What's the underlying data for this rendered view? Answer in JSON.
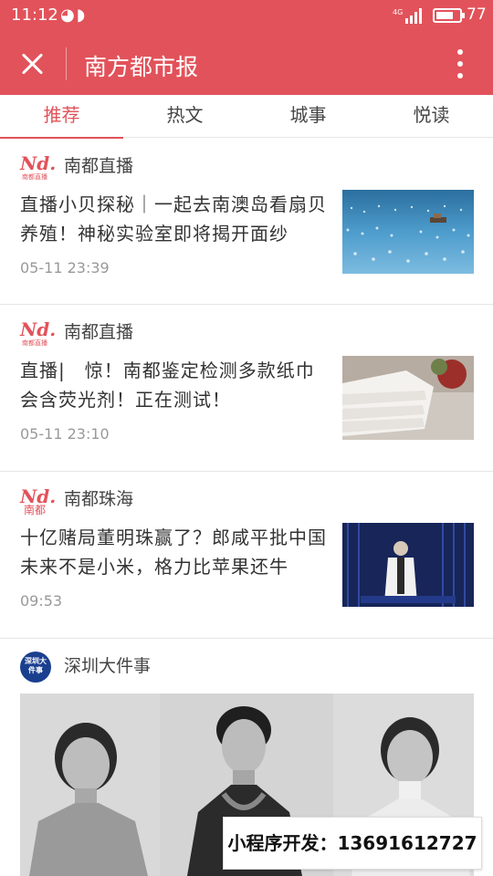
{
  "status_bar": {
    "time": "11:12",
    "network": "4G",
    "battery": "77",
    "battery_level": 0.77
  },
  "header": {
    "title": "南方都市报",
    "background": "#e2525a",
    "close_icon": "close-icon",
    "more_icon": "more-vertical-icon"
  },
  "tabs": [
    {
      "label": "推荐",
      "active": true
    },
    {
      "label": "热文",
      "active": false
    },
    {
      "label": "城事",
      "active": false
    },
    {
      "label": "悦读",
      "active": false
    }
  ],
  "articles": [
    {
      "source": "南都直播",
      "logo_text": "Nd.",
      "logo_sub": "南都直播",
      "headline": "直播小贝探秘｜一起去南澳岛看扇贝养殖！神秘实验室即将揭开面纱",
      "time": "05-11 23:39"
    },
    {
      "source": "南都直播",
      "logo_text": "Nd.",
      "logo_sub": "南都直播",
      "headline": "直播|　惊！南都鉴定检测多款纸巾会含荧光剂！正在测试！",
      "time": "05-11 23:10"
    },
    {
      "source": "南都珠海",
      "logo_text": "Nd.",
      "logo_sub": "南都",
      "headline": "十亿赌局董明珠赢了？郎咸平批中国未来不是小米，格力比苹果还牛",
      "time": "09:53"
    },
    {
      "source": "深圳大件事",
      "logo_text": "深圳大件事"
    }
  ],
  "watermark": "小程序开发：13691612727"
}
